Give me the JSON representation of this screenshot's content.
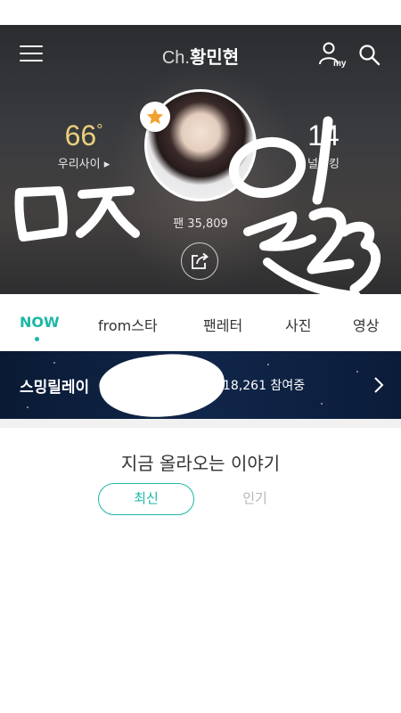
{
  "header": {
    "channel_prefix": "Ch.",
    "channel_name": "황민현"
  },
  "icons": {
    "menu": "menu-icon",
    "my": "my-profile-icon",
    "search": "search-icon",
    "star": "star-icon",
    "share": "share-icon",
    "chevron": "chevron-right-icon"
  },
  "profile": {
    "closeness_value": "66",
    "closeness_unit": "°",
    "closeness_label": "우리사이 ▸",
    "rank_value": "14",
    "rank_label": "널랭킹",
    "fans_label": "팬 35,809"
  },
  "scribbles": {
    "left_text": "ㅁㅈ",
    "right_text": "일23"
  },
  "tabs": [
    {
      "label": "NOW",
      "active": true
    },
    {
      "label": "from스타",
      "active": false
    },
    {
      "label": "팬레터",
      "active": false
    },
    {
      "label": "사진",
      "active": false
    },
    {
      "label": "영상",
      "active": false
    }
  ],
  "banner": {
    "title": "스밍릴레이",
    "participants": "18,261 참여중"
  },
  "feed": {
    "section_title": "지금 올라오는 이야기",
    "sort_latest": "최신",
    "sort_popular": "인기"
  },
  "colors": {
    "accent": "#1bb8a6",
    "gold": "#e9cf7a",
    "banner_bg": "#10264a"
  }
}
